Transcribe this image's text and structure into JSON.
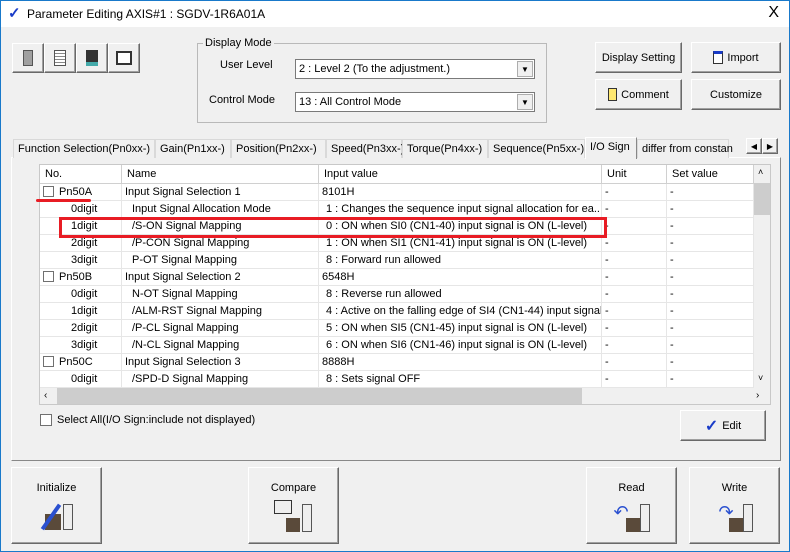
{
  "window": {
    "title": "Parameter Editing AXIS#1 : SGDV-1R6A01A",
    "close": "X"
  },
  "toolbar": {
    "icons": [
      "new-icon",
      "open-icon",
      "save-icon",
      "print-icon"
    ]
  },
  "display_mode": {
    "legend": "Display Mode",
    "user_level_label": "User Level",
    "user_level_value": "2 : Level 2 (To the adjustment.)",
    "control_mode_label": "Control Mode",
    "control_mode_value": "13 : All Control Mode"
  },
  "buttons": {
    "display_setting": "Display Setting",
    "import": "Import",
    "comment": "Comment",
    "customize": "Customize",
    "edit": "Edit",
    "initialize": "Initialize",
    "compare": "Compare",
    "read": "Read",
    "write": "Write"
  },
  "tabs": [
    {
      "label": "Function Selection(Pn0xx-)"
    },
    {
      "label": "Gain(Pn1xx-)"
    },
    {
      "label": "Position(Pn2xx-)"
    },
    {
      "label": "Speed(Pn3xx-)"
    },
    {
      "label": "Torque(Pn4xx-)"
    },
    {
      "label": "Sequence(Pn5xx-)"
    },
    {
      "label": "I/O Sign",
      "active": true
    },
    {
      "label": "differ from constan"
    }
  ],
  "table": {
    "columns": [
      "No.",
      "Name",
      "Input value",
      "Unit",
      "Set value"
    ],
    "rows": [
      {
        "no": "Pn50A",
        "name": "Input Signal Selection 1",
        "value": "8101H",
        "unit": "-",
        "set": "-",
        "parent": true
      },
      {
        "no": "0digit",
        "name": "Input Signal Allocation Mode",
        "value": "1 : Changes the sequence input signal allocation for ea...",
        "unit": "-",
        "set": "-"
      },
      {
        "no": "1digit",
        "name": "/S-ON Signal Mapping",
        "value": "0 : ON when SI0 (CN1-40) input signal is ON (L-level)",
        "unit": "-",
        "set": "-"
      },
      {
        "no": "2digit",
        "name": "/P-CON Signal Mapping",
        "value": "1 : ON when SI1 (CN1-41) input signal is ON (L-level)",
        "unit": "-",
        "set": "-"
      },
      {
        "no": "3digit",
        "name": "P-OT Signal Mapping",
        "value": "8 : Forward run allowed",
        "unit": "-",
        "set": "-"
      },
      {
        "no": "Pn50B",
        "name": "Input Signal Selection 2",
        "value": "6548H",
        "unit": "-",
        "set": "-",
        "parent": true
      },
      {
        "no": "0digit",
        "name": "N-OT Signal Mapping",
        "value": "8 : Reverse run allowed",
        "unit": "-",
        "set": "-"
      },
      {
        "no": "1digit",
        "name": "/ALM-RST Signal Mapping",
        "value": "4 : Active on the falling edge of SI4 (CN1-44) input signal",
        "unit": "-",
        "set": "-"
      },
      {
        "no": "2digit",
        "name": "/P-CL Signal Mapping",
        "value": "5 : ON when SI5 (CN1-45) input signal is ON (L-level)",
        "unit": "-",
        "set": "-"
      },
      {
        "no": "3digit",
        "name": "/N-CL Signal Mapping",
        "value": "6 : ON when SI6 (CN1-46) input signal is ON (L-level)",
        "unit": "-",
        "set": "-"
      },
      {
        "no": "Pn50C",
        "name": "Input Signal Selection 3",
        "value": "8888H",
        "unit": "-",
        "set": "-",
        "parent": true
      },
      {
        "no": "0digit",
        "name": "/SPD-D Signal Mapping",
        "value": "8 : Sets signal OFF",
        "unit": "-",
        "set": "-"
      }
    ]
  },
  "select_all": {
    "label": "Select All(I/O Sign:include not displayed)",
    "checked": false
  },
  "colors": {
    "highlight": "#e81c24",
    "accent": "#1a3cc8"
  }
}
